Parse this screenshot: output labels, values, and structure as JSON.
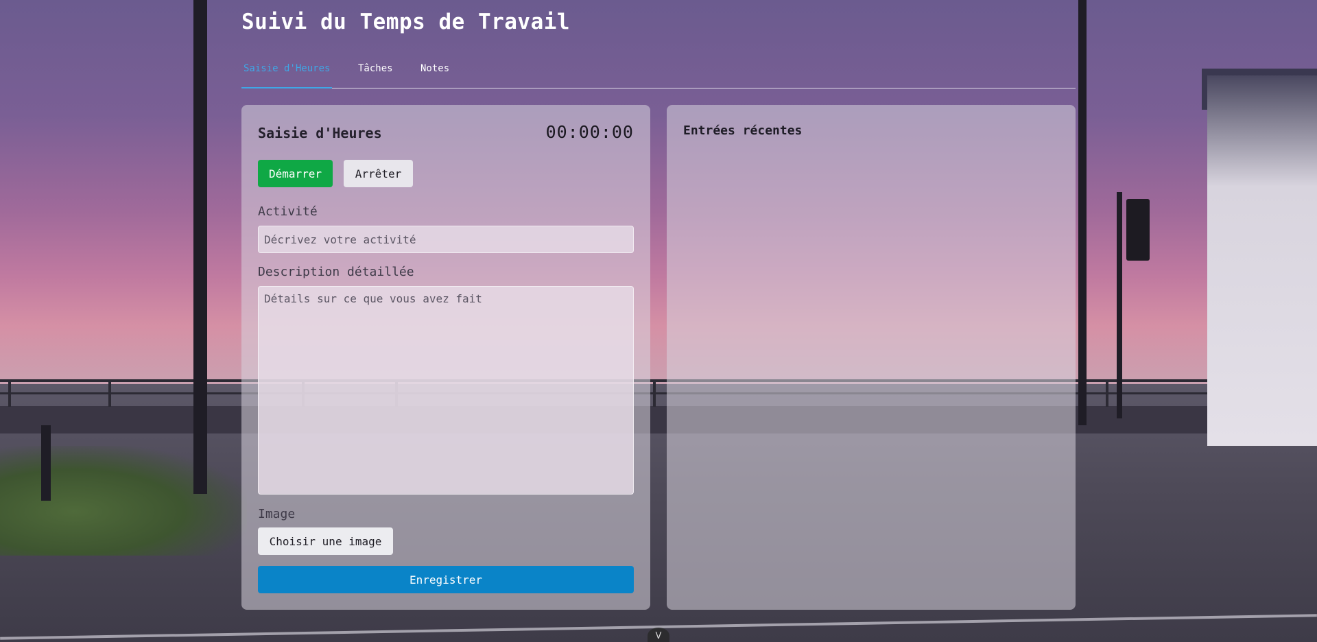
{
  "app": {
    "title": "Suivi du Temps de Travail"
  },
  "tabs": [
    {
      "label": "Saisie d'Heures",
      "active": true
    },
    {
      "label": "Tâches",
      "active": false
    },
    {
      "label": "Notes",
      "active": false
    }
  ],
  "time_entry": {
    "title": "Saisie d'Heures",
    "timer": "00:00:00",
    "start_label": "Démarrer",
    "stop_label": "Arrêter",
    "activity_label": "Activité",
    "activity_placeholder": "Décrivez votre activité",
    "activity_value": "",
    "description_label": "Description détaillée",
    "description_placeholder": "Détails sur ce que vous avez fait",
    "description_value": "",
    "image_label": "Image",
    "choose_image_label": "Choisir une image",
    "save_label": "Enregistrer"
  },
  "recent": {
    "title": "Entrées récentes",
    "entries": []
  },
  "scroll_indicator": {
    "glyph": "V"
  },
  "colors": {
    "accent_tab": "#3fa7e6",
    "start_button": "#0fa845",
    "save_button": "#0a84c8"
  }
}
